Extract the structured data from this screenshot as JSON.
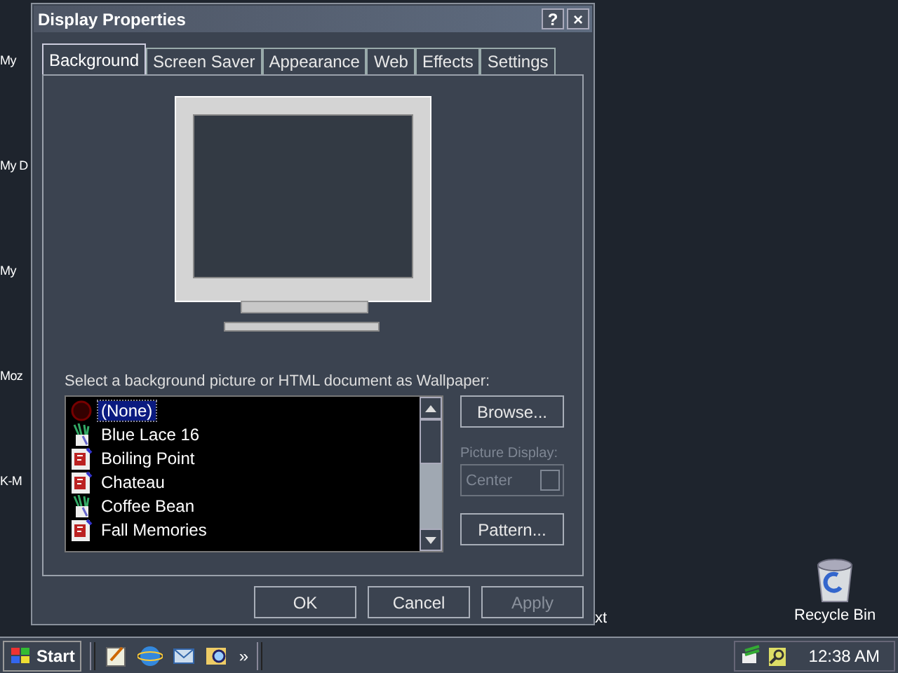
{
  "desktop_icons": [
    {
      "label": "My"
    },
    {
      "label": "My D"
    },
    {
      "label": "My"
    },
    {
      "label": "Moz"
    },
    {
      "label": "K-M"
    }
  ],
  "desktop_fragment": "xt",
  "recycle_bin": {
    "label": "Recycle Bin"
  },
  "window": {
    "title": "Display Properties",
    "help_button": "?",
    "close_button": "×"
  },
  "tabs": [
    {
      "label": "Background",
      "selected": true
    },
    {
      "label": "Screen Saver",
      "selected": false
    },
    {
      "label": "Appearance",
      "selected": false
    },
    {
      "label": "Web",
      "selected": false
    },
    {
      "label": "Effects",
      "selected": false
    },
    {
      "label": "Settings",
      "selected": false
    }
  ],
  "wallpaper_prompt": "Select a background picture or HTML document as Wallpaper:",
  "wallpapers": [
    {
      "label": "(None)",
      "kind": "none",
      "selected": true
    },
    {
      "label": "Blue Lace 16",
      "kind": "html",
      "selected": false
    },
    {
      "label": "Boiling Point",
      "kind": "bitmap",
      "selected": false
    },
    {
      "label": "Chateau",
      "kind": "bitmap",
      "selected": false
    },
    {
      "label": "Coffee Bean",
      "kind": "html",
      "selected": false
    },
    {
      "label": "Fall Memories",
      "kind": "bitmap",
      "selected": false
    }
  ],
  "browse_button": "Browse...",
  "picture_display": {
    "label": "Picture Display:",
    "value": "Center",
    "disabled": true
  },
  "pattern_button": "Pattern...",
  "buttons": [
    {
      "label": "OK",
      "disabled": false
    },
    {
      "label": "Cancel",
      "disabled": false
    },
    {
      "label": "Apply",
      "disabled": true
    }
  ],
  "taskbar": {
    "start": "Start",
    "chevron": "»",
    "clock": "12:38 AM"
  }
}
